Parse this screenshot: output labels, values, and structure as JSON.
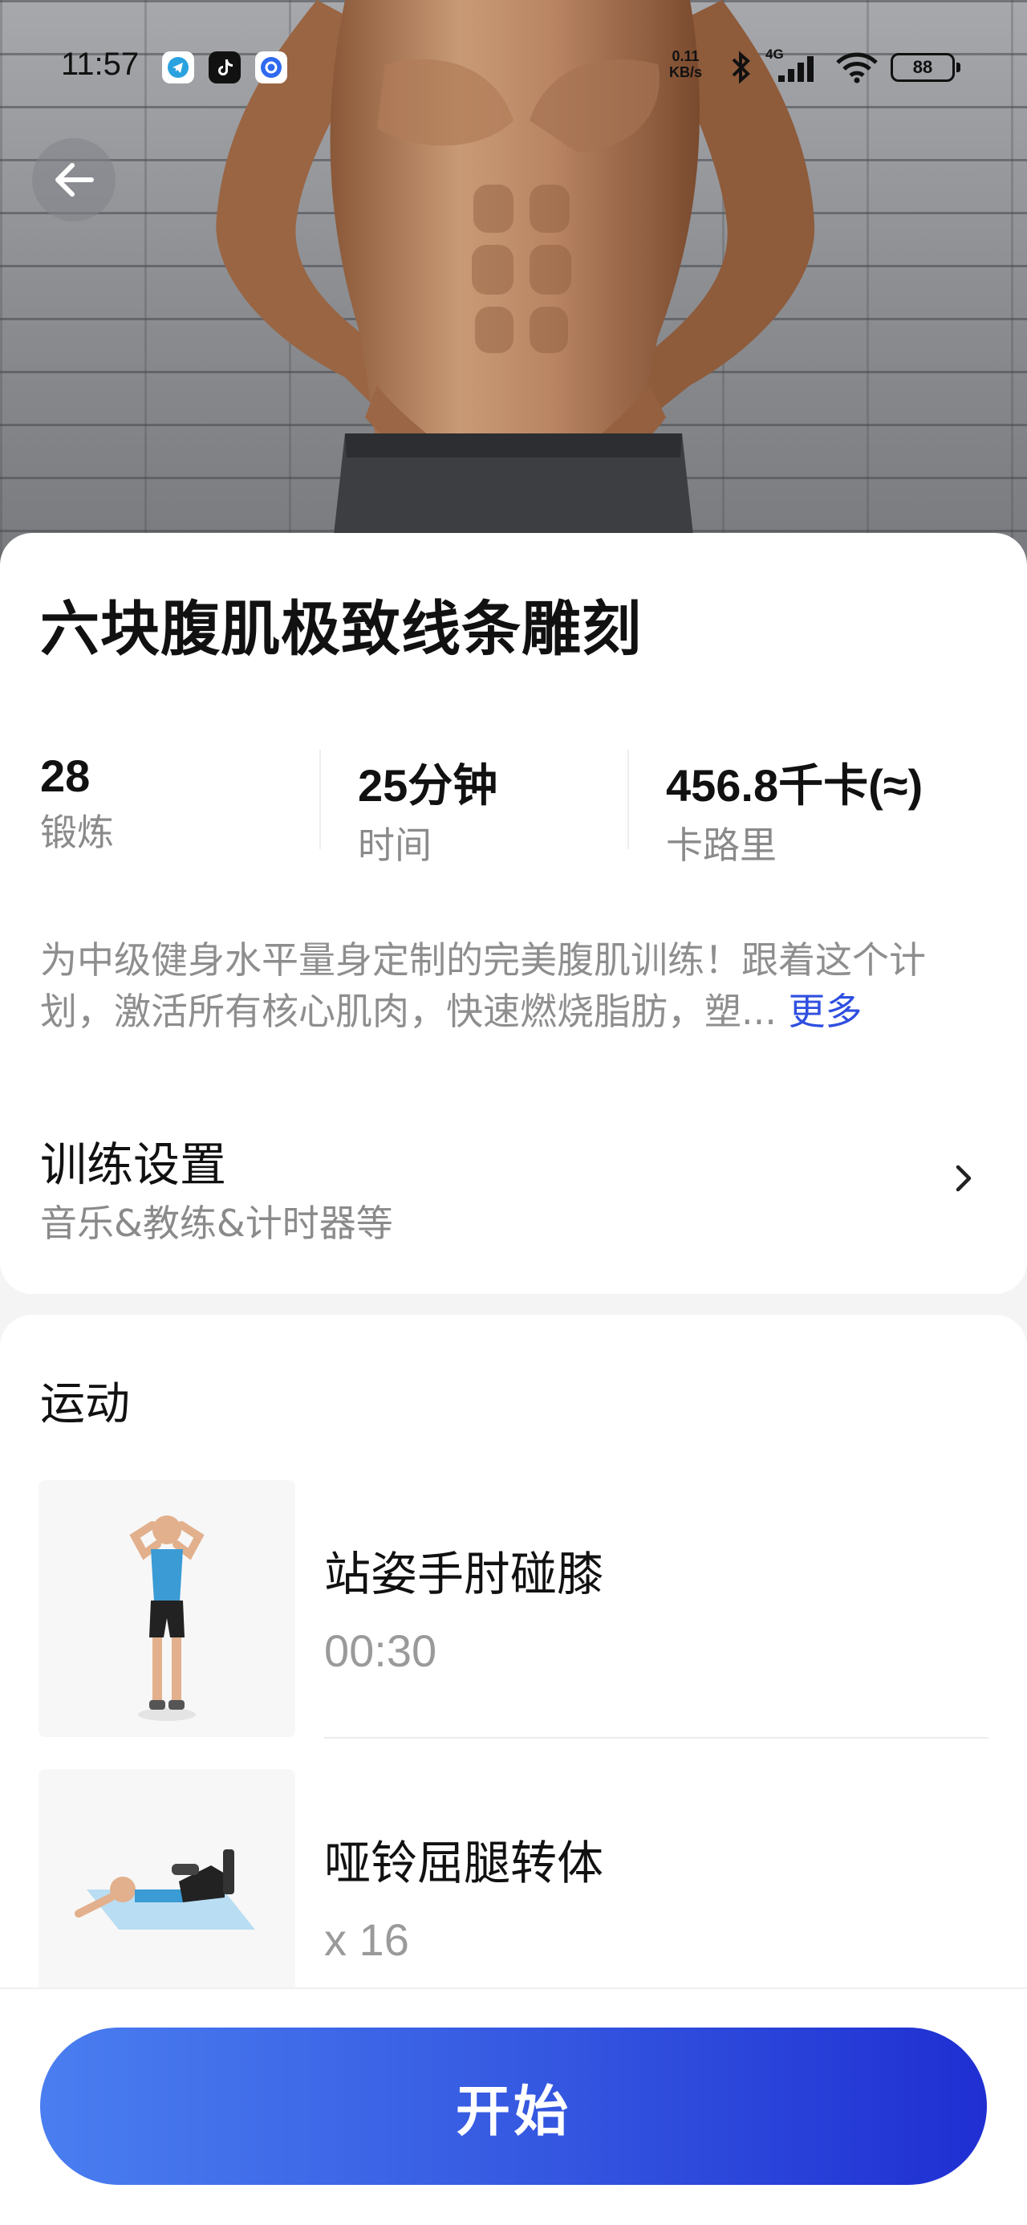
{
  "status_bar": {
    "time": "11:57",
    "net_speed_value": "0.11",
    "net_speed_unit": "KB/s",
    "network_type": "4G",
    "battery": "88",
    "apps": [
      "telegram-icon",
      "tiktok-icon",
      "browser-icon"
    ]
  },
  "nav": {
    "back_icon": "arrow-left-icon"
  },
  "plan": {
    "title": "六块腹肌极致线条雕刻",
    "stats": [
      {
        "value": "28",
        "label": "锻炼"
      },
      {
        "value": "25分钟",
        "label": "时间"
      },
      {
        "value": "456.8千卡(≈)",
        "label": "卡路里"
      }
    ],
    "description": "为中级健身水平量身定制的完美腹肌训练！跟着这个计划，激活所有核心肌肉，快速燃烧脂肪，塑...",
    "more_label": "更多"
  },
  "settings": {
    "title": "训练设置",
    "subtitle": "音乐&教练&计时器等",
    "chevron_icon": "chevron-right-icon"
  },
  "exercises": {
    "heading": "运动",
    "items": [
      {
        "name": "站姿手肘碰膝",
        "amount": "00:30"
      },
      {
        "name": "哑铃屈腿转体",
        "amount": "x 16"
      }
    ]
  },
  "actions": {
    "start_label": "开始"
  },
  "colors": {
    "accent": "#3456e0",
    "link": "#2f4fe0",
    "muted_text": "#8a8a8a"
  }
}
